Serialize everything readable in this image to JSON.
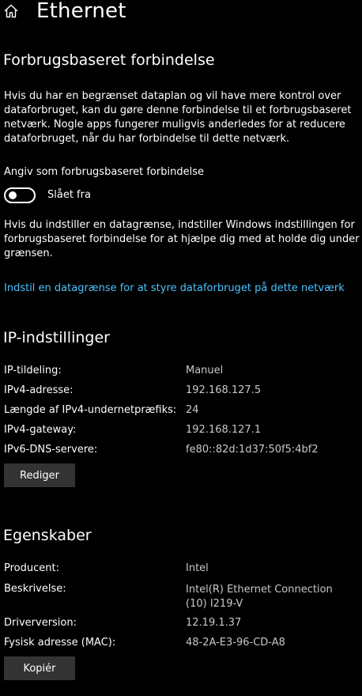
{
  "header": {
    "home_icon": "home-icon",
    "title": "Ethernet"
  },
  "metered": {
    "title": "Forbrugsbaseret forbindelse",
    "description": "Hvis du har en begrænset dataplan og vil have mere kontrol over dataforbruget, kan du gøre denne forbindelse til et forbrugsbaseret netværk. Nogle apps fungerer muligvis anderledes for at reducere dataforbruget, når du har forbindelse til dette netværk.",
    "toggle_heading": "Angiv som forbrugsbaseret forbindelse",
    "toggle_state": "Slået fra",
    "toggle_on": false,
    "limit_text": "Hvis du indstiller en datagrænse, indstiller Windows indstillingen for forbrugsbaseret forbindelse for at hjælpe dig med at holde dig under grænsen.",
    "limit_link": "Indstil en datagrænse for at styre dataforbruget på dette netværk"
  },
  "ip_settings": {
    "title": "IP-indstillinger",
    "rows": [
      {
        "label": "IP-tildeling:",
        "value": "Manuel"
      },
      {
        "label": "IPv4-adresse:",
        "value": "192.168.127.5"
      },
      {
        "label": "Længde af IPv4-undernetpræfiks:",
        "value": "24"
      },
      {
        "label": "IPv4-gateway:",
        "value": "192.168.127.1"
      },
      {
        "label": "IPv6-DNS-servere:",
        "value": "fe80::82d:1d37:50f5:4bf2"
      }
    ],
    "edit_button": "Rediger"
  },
  "properties": {
    "title": "Egenskaber",
    "rows": [
      {
        "label": "Producent:",
        "value": "Intel"
      },
      {
        "label": "Beskrivelse:",
        "value": "Intel(R) Ethernet Connection (10) I219-V"
      },
      {
        "label": "Driverversion:",
        "value": "12.19.1.37"
      },
      {
        "label": "Fysisk adresse (MAC):",
        "value": "48-2A-E3-96-CD-A8"
      }
    ],
    "copy_button": "Kopiér"
  },
  "colors": {
    "background": "#000000",
    "text": "#ffffff",
    "value_text": "#c8c8c8",
    "link": "#4cc2ff",
    "button_bg": "#333333"
  }
}
